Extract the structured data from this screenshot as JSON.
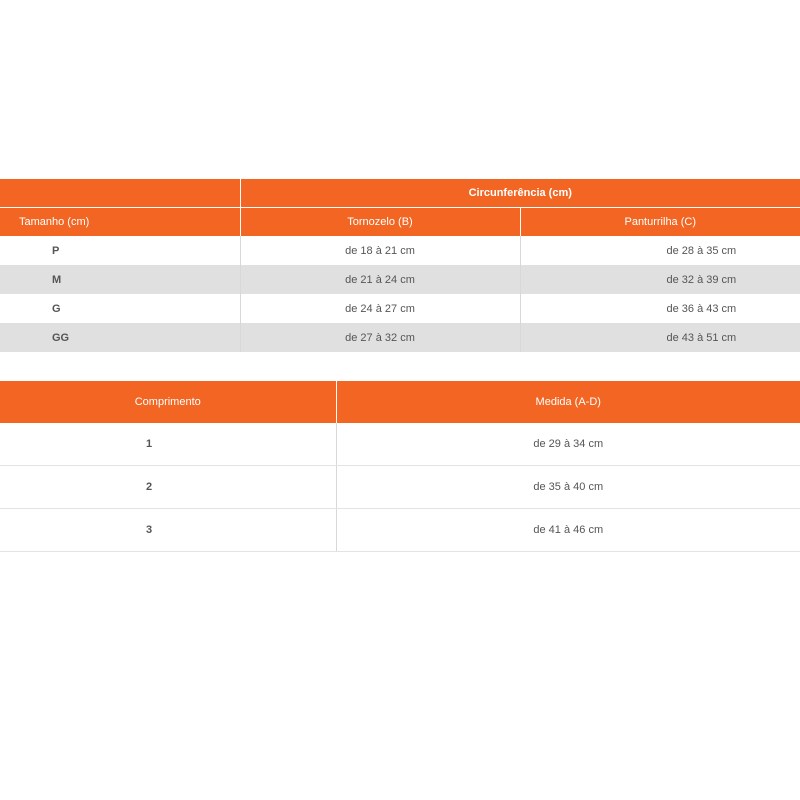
{
  "size_table": {
    "group_header": "Circunferência (cm)",
    "columns": [
      "Tamanho (cm)",
      "Tornozelo (B)",
      "Panturrilha (C)"
    ],
    "rows": [
      {
        "size": "P",
        "ankle": "de 18 à 21 cm",
        "calf": "de 28 à 35 cm"
      },
      {
        "size": "M",
        "ankle": "de 21 à 24 cm",
        "calf": "de 32 à 39 cm"
      },
      {
        "size": "G",
        "ankle": "de 24 à 27 cm",
        "calf": "de 36 à 43 cm"
      },
      {
        "size": "GG",
        "ankle": "de 27 à 32 cm",
        "calf": "de 43 à 51 cm"
      }
    ]
  },
  "length_table": {
    "columns": [
      "Comprimento",
      "Medida (A-D)"
    ],
    "rows": [
      {
        "length": "1",
        "measure": "de 29 à 34 cm"
      },
      {
        "length": "2",
        "measure": "de 35 à 40 cm"
      },
      {
        "length": "3",
        "measure": "de 41 à 46 cm"
      }
    ]
  },
  "colors": {
    "header_orange": "#f26522",
    "zebra_gray": "#e0e0e0",
    "text": "#555555"
  }
}
